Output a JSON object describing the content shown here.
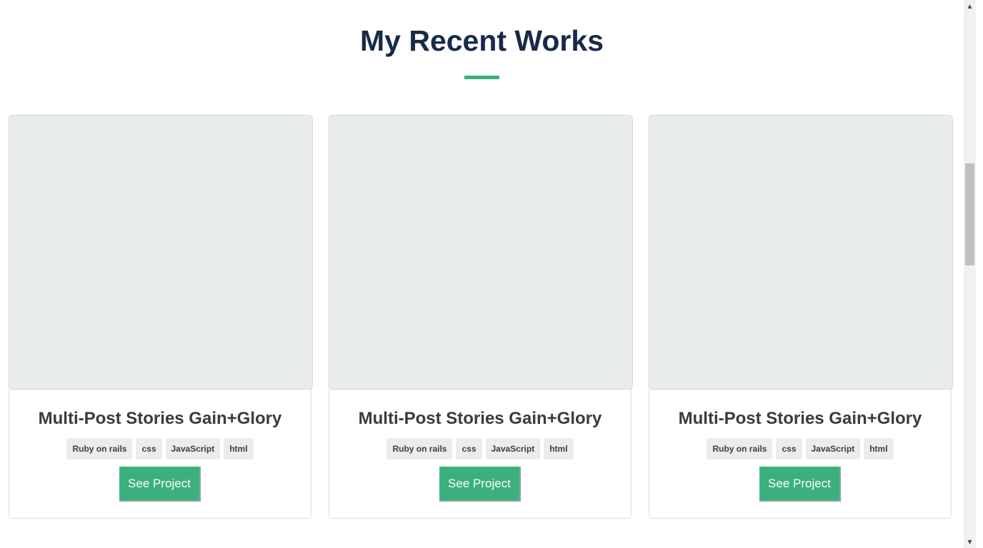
{
  "section": {
    "title": "My Recent Works",
    "accent_color": "#3bb07e",
    "title_color": "#172a4a"
  },
  "cards": [
    {
      "title": "Multi-Post Stories Gain+Glory",
      "tags": [
        "Ruby on rails",
        "css",
        "JavaScript",
        "html"
      ],
      "button_label": "See Project"
    },
    {
      "title": "Multi-Post Stories Gain+Glory",
      "tags": [
        "Ruby on rails",
        "css",
        "JavaScript",
        "html"
      ],
      "button_label": "See Project"
    },
    {
      "title": "Multi-Post Stories Gain+Glory",
      "tags": [
        "Ruby on rails",
        "css",
        "JavaScript",
        "html"
      ],
      "button_label": "See Project"
    }
  ],
  "scrollbar": {
    "up_icon": "triangle-up-icon",
    "down_icon": "triangle-down-icon"
  }
}
